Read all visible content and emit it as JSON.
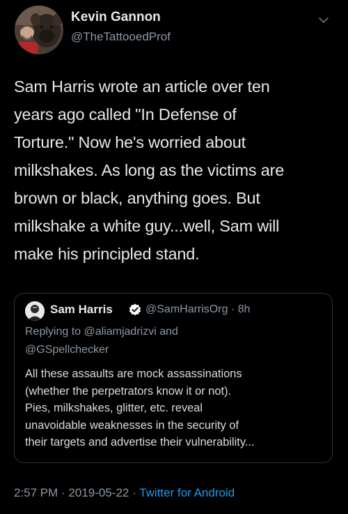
{
  "tweet": {
    "author": {
      "name": "Kevin Gannon",
      "handle": "@TheTattooedProf"
    },
    "body": "Sam Harris wrote an article over ten\nyears ago called \"In Defense of\nTorture.\" Now he's worried about\nmilkshakes. As long as the victims are\nbrown or black, anything goes. But\nmilkshake a white guy...well, Sam will\nmake his principled stand.",
    "quoted": {
      "name": "Sam Harris",
      "handle_time": "@SamHarrisOrg · 8h",
      "replying_prefix": "Replying to",
      "replying_to_1": "@aliamjadrizvi",
      "replying_and": "and",
      "replying_to_2": "@GSpellchecker",
      "text": "All these assaults are mock assassinations\n(whether the perpetrators know it or not).\nPies, milkshakes, glitter, etc. reveal\nunavoidable weaknesses in the security of\ntheir targets and advertise their vulnerability..."
    },
    "meta": {
      "timestamp": "2:57 PM · 2019-05-22 · ",
      "source": "Twitter for Android"
    }
  },
  "icons": {
    "menu": "chevron-down-icon",
    "verified": "verified-badge-icon"
  },
  "colors": {
    "background": "#000000",
    "text_primary": "#e9e9e9",
    "text_secondary": "#8b98a5",
    "link": "#1d9bf0",
    "verified": "#1d9bf0",
    "border": "#2f3336"
  }
}
